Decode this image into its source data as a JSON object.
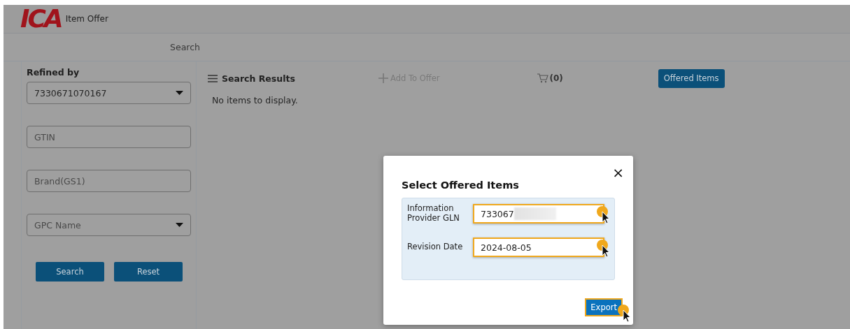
{
  "header": {
    "logo": "ICA",
    "title": "Item Offer"
  },
  "nav": {
    "tab": "Search"
  },
  "sidebar": {
    "heading": "Refined by",
    "fields": [
      {
        "kind": "select",
        "value": "7330671070167"
      },
      {
        "kind": "input",
        "placeholder": "GTIN"
      },
      {
        "kind": "input",
        "placeholder": "Brand(GS1)"
      },
      {
        "kind": "select",
        "placeholder": "GPC Name"
      }
    ],
    "buttons": [
      "Search",
      "Reset"
    ]
  },
  "results": {
    "title": "Search Results",
    "add_to_offer": {
      "label": "Add To Offer",
      "disabled": true
    },
    "cart_count": "(0)",
    "offered_button": "Offered Items",
    "empty_message": "No items to display."
  },
  "dialog": {
    "title": "Select Offered Items",
    "close": "×",
    "fields": [
      {
        "label": "Information Provider GLN",
        "value": "733067",
        "redacted": true,
        "highlighted": true
      },
      {
        "label": "Revision Date",
        "value": "2024-08-05",
        "highlighted": true
      }
    ],
    "export_button": {
      "label": "Export",
      "highlighted": true
    }
  }
}
